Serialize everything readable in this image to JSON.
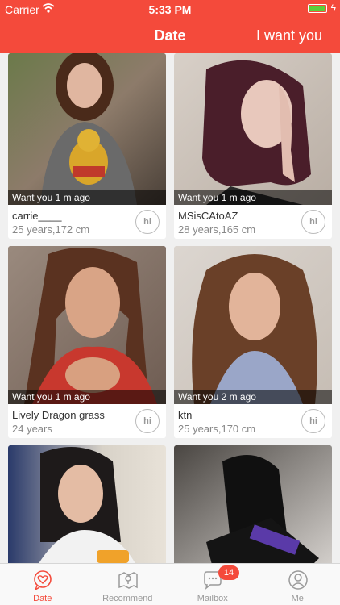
{
  "status_bar": {
    "carrier": "Carrier",
    "time": "5:33 PM"
  },
  "nav": {
    "title": "Date",
    "right_button": "I want you"
  },
  "colors": {
    "accent": "#f44a3b",
    "battery": "#5ccf3a"
  },
  "cards": [
    {
      "status": "Want you 1 m ago",
      "name": "carrie____",
      "details": "25 years,172 cm",
      "hi": "hi"
    },
    {
      "status": "Want you 1 m ago",
      "name": "MSisCAtoAZ",
      "details": "28 years,165 cm",
      "hi": "hi"
    },
    {
      "status": "Want you 1 m ago",
      "name": "Lively Dragon grass",
      "details": "24 years",
      "hi": "hi"
    },
    {
      "status": "Want you 2 m ago",
      "name": "ktn",
      "details": "25 years,170 cm",
      "hi": "hi"
    },
    {
      "status": "",
      "name": "",
      "details": "",
      "hi": ""
    },
    {
      "status": "",
      "name": "",
      "details": "",
      "hi": ""
    }
  ],
  "tabs": [
    {
      "label": "Date",
      "icon": "heart-chat-icon",
      "active": true
    },
    {
      "label": "Recommend",
      "icon": "map-icon",
      "active": false
    },
    {
      "label": "Mailbox",
      "icon": "chat-bubble-icon",
      "active": false,
      "badge": "14"
    },
    {
      "label": "Me",
      "icon": "user-icon",
      "active": false
    }
  ]
}
